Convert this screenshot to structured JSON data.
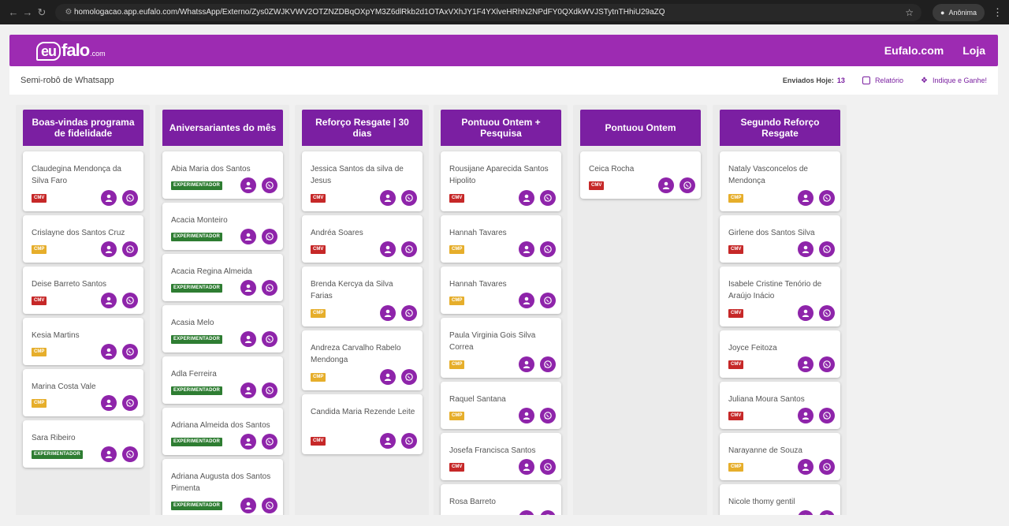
{
  "browser": {
    "url": "homologacao.app.eufalo.com/WhatssApp/Externo/Zys0ZWJKVWV2OTZNZDBqOXpYM3Z6dlRkb2d1OTAxVXhJY1F4YXlveHRhN2NPdFY0QXdkWVJSTytnTHhiU29aZQ",
    "incognito_label": "Anônima"
  },
  "header": {
    "logo_main": "eu",
    "logo_rest": "falo",
    "logo_com": ".com",
    "links": [
      "Eufalo.com",
      "Loja"
    ]
  },
  "subbar": {
    "title": "Semi-robô de Whatsapp",
    "sent_label": "Enviados Hoje:",
    "sent_count": "13",
    "report_label": "Relatório",
    "refer_label": "Indique e Ganhe!"
  },
  "colors": {
    "brand": "#9d2bb2",
    "column_header": "#7b1fa2",
    "button": "#8e24aa",
    "cmv": "#c62828",
    "cmp": "#e6ae2b",
    "experimentador": "#2e7d32"
  },
  "columns": [
    {
      "title": "Boas-vindas programa de fidelidade",
      "cards": [
        {
          "name": "Claudegina Mendonça da Silva Faro",
          "tag": "CMV"
        },
        {
          "name": "Crislayne dos Santos Cruz",
          "tag": "CMP"
        },
        {
          "name": "Deise Barreto Santos",
          "tag": "CMV"
        },
        {
          "name": "Kesia Martins",
          "tag": "CMP"
        },
        {
          "name": "Marina Costa Vale",
          "tag": "CMP"
        },
        {
          "name": "Sara Ribeiro",
          "tag": "EXPERIMENTADOR"
        }
      ]
    },
    {
      "title": "Aniversariantes do mês",
      "cards": [
        {
          "name": "Abia Maria dos Santos",
          "tag": "EXPERIMENTADOR"
        },
        {
          "name": "Acacia Monteiro",
          "tag": "EXPERIMENTADOR"
        },
        {
          "name": "Acacia Regina Almeida",
          "tag": "EXPERIMENTADOR"
        },
        {
          "name": "Acasia Melo",
          "tag": "EXPERIMENTADOR"
        },
        {
          "name": "Adla Ferreira",
          "tag": "EXPERIMENTADOR"
        },
        {
          "name": "Adriana Almeida dos Santos",
          "tag": "EXPERIMENTADOR"
        },
        {
          "name": "Adriana Augusta dos Santos Pimenta",
          "tag": "EXPERIMENTADOR"
        }
      ]
    },
    {
      "title": "Reforço Resgate | 30 dias",
      "cards": [
        {
          "name": "Jessica Santos da silva de Jesus",
          "tag": "CMV"
        },
        {
          "name": "Andréa Soares",
          "tag": "CMV"
        },
        {
          "name": "Brenda Kercya da Silva Farias",
          "tag": "CMP"
        },
        {
          "name": "Andreza Carvalho Rabelo Mendonga",
          "tag": "CMP"
        },
        {
          "name": "Candida Maria Rezende Leite",
          "tag": "CMV"
        }
      ]
    },
    {
      "title": "Pontuou Ontem + Pesquisa",
      "cards": [
        {
          "name": "Rousijane Aparecida Santos Hipolito",
          "tag": "CMV"
        },
        {
          "name": "Hannah Tavares",
          "tag": "CMP"
        },
        {
          "name": "Hannah Tavares",
          "tag": "CMP"
        },
        {
          "name": "Paula Virginia Gois Silva Correa",
          "tag": "CMP"
        },
        {
          "name": "Raquel Santana",
          "tag": "CMP"
        },
        {
          "name": "Josefa Francisca Santos",
          "tag": "CMV"
        },
        {
          "name": "Rosa Barreto",
          "tag": ""
        }
      ]
    },
    {
      "title": "Pontuou Ontem",
      "cards": [
        {
          "name": "Ceica Rocha",
          "tag": "CMV"
        }
      ]
    },
    {
      "title": "Segundo Reforço Resgate",
      "cards": [
        {
          "name": "Nataly Vasconcelos de Mendonça",
          "tag": "CMP"
        },
        {
          "name": "Girlene dos Santos Silva",
          "tag": "CMV"
        },
        {
          "name": "Isabele Cristine Tenório de Araújo Inácio",
          "tag": "CMV"
        },
        {
          "name": "Joyce Feitoza",
          "tag": "CMV"
        },
        {
          "name": "Juliana Moura Santos",
          "tag": "CMV"
        },
        {
          "name": "Narayanne de Souza",
          "tag": "CMP"
        },
        {
          "name": "Nicole thomy gentil",
          "tag": ""
        }
      ]
    }
  ]
}
